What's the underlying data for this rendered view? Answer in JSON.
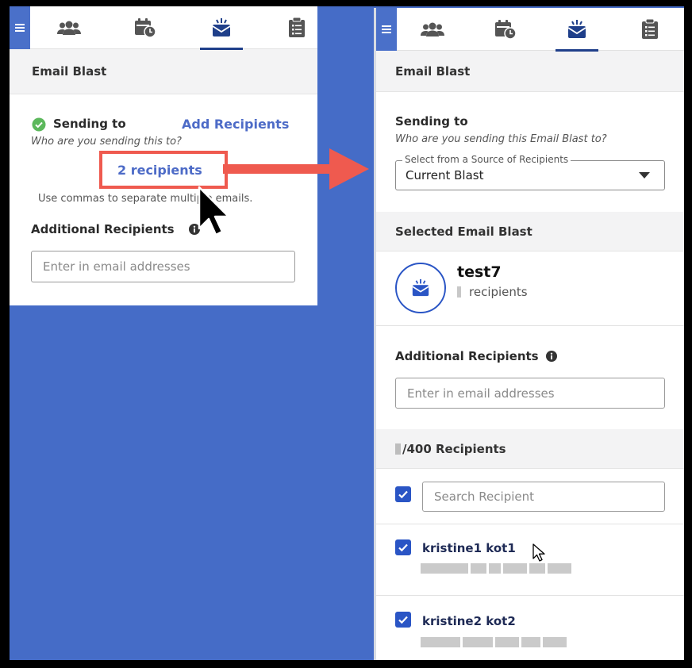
{
  "left_panel": {
    "header_title": "Email Blast",
    "sending_to_label": "Sending to",
    "add_recipients_link": "Add Recipients",
    "sending_to_hint": "Who are you sending this to?",
    "recipients_link": "2 recipients",
    "commas_hint": "Use commas to separate multiple emails.",
    "additional_recipients_label": "Additional Recipients",
    "email_placeholder": "Enter in email addresses"
  },
  "right_panel": {
    "header_title": "Email Blast",
    "sending_to_label": "Sending to",
    "sending_to_hint": "Who are you sending this Email Blast to?",
    "source_select_legend": "Select from a Source of Recipients",
    "source_select_value": "Current Blast",
    "selected_blast_title": "Selected Email Blast",
    "blast_name": "test7",
    "blast_recipients_suffix": "recipients",
    "additional_recipients_label": "Additional Recipients",
    "email_placeholder": "Enter in email addresses",
    "recipients_count_label": "/400 Recipients",
    "search_placeholder": "Search Recipient",
    "recipients": [
      {
        "name": "kristine1 kot1",
        "checked": true
      },
      {
        "name": "kristine2 kot2",
        "checked": true
      }
    ]
  },
  "tabs": [
    {
      "name": "people",
      "icon": "people-icon"
    },
    {
      "name": "schedule",
      "icon": "calendar-clock-icon"
    },
    {
      "name": "email-blast",
      "icon": "email-blast-icon",
      "active": true
    },
    {
      "name": "clipboard",
      "icon": "clipboard-icon"
    }
  ],
  "colors": {
    "accent": "#4a70c9",
    "link": "#4d6bc7",
    "background_blue": "#456cc7",
    "highlight_red": "#ef5a4f",
    "checkbox": "#2a55c5",
    "success": "#5cb85c"
  }
}
